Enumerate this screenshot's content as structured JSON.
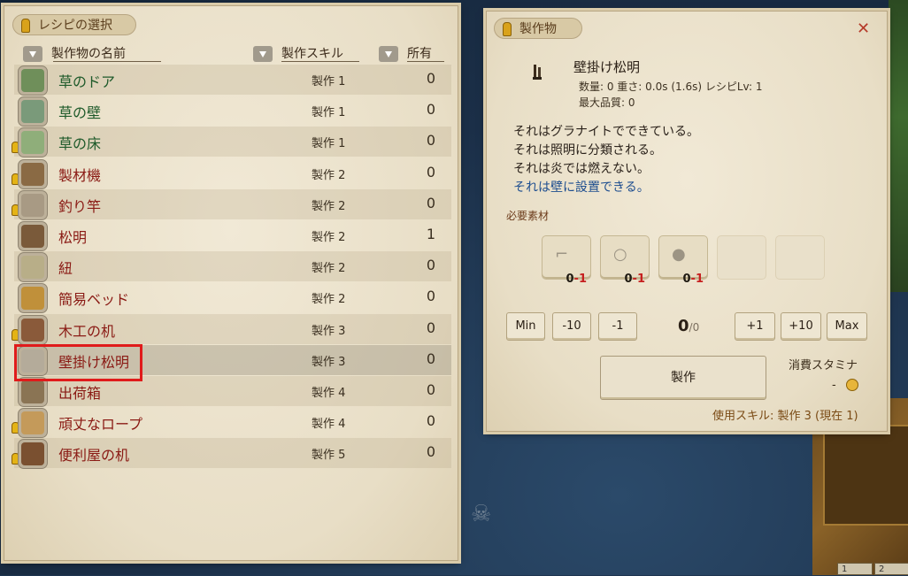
{
  "left_panel": {
    "title": "レシピの選択",
    "headers": {
      "name": "製作物の名前",
      "skill": "製作スキル",
      "owned": "所有"
    },
    "rows": [
      {
        "name": "草のドア",
        "skill": "製作 1",
        "owned": "0",
        "name_color": "#1e5a2a",
        "bulb": false,
        "icon": "grass-door-icon",
        "icon_color": "#6f8f5a"
      },
      {
        "name": "草の壁",
        "skill": "製作 1",
        "owned": "0",
        "name_color": "#1e5a2a",
        "bulb": false,
        "icon": "grass-wall-icon",
        "icon_color": "#7a9a7a"
      },
      {
        "name": "草の床",
        "skill": "製作 1",
        "owned": "0",
        "name_color": "#1e5a2a",
        "bulb": true,
        "icon": "grass-floor-icon",
        "icon_color": "#8fae7a"
      },
      {
        "name": "製材機",
        "skill": "製作 2",
        "owned": "0",
        "name_color": "#8a1a14",
        "bulb": true,
        "icon": "sawmill-icon",
        "icon_color": "#8a6a44"
      },
      {
        "name": "釣り竿",
        "skill": "製作 2",
        "owned": "0",
        "name_color": "#8a1a14",
        "bulb": true,
        "icon": "fishing-rod-icon",
        "icon_color": "#a89a84"
      },
      {
        "name": "松明",
        "skill": "製作 2",
        "owned": "1",
        "name_color": "#8a1a14",
        "bulb": false,
        "icon": "torch-icon",
        "icon_color": "#7a5a3a"
      },
      {
        "name": "紐",
        "skill": "製作 2",
        "owned": "0",
        "name_color": "#8a1a14",
        "bulb": false,
        "icon": "string-icon",
        "icon_color": "#b8ae88"
      },
      {
        "name": "簡易ベッド",
        "skill": "製作 2",
        "owned": "0",
        "name_color": "#8a1a14",
        "bulb": false,
        "icon": "simple-bed-icon",
        "icon_color": "#c0903a"
      },
      {
        "name": "木工の机",
        "skill": "製作 3",
        "owned": "0",
        "name_color": "#8a1a14",
        "bulb": true,
        "icon": "woodwork-desk-icon",
        "icon_color": "#8a5a3a"
      },
      {
        "name": "壁掛け松明",
        "skill": "製作 3",
        "owned": "0",
        "name_color": "#8a1a14",
        "bulb": false,
        "icon": "wall-torch-icon",
        "icon_color": "#b4ab9a"
      },
      {
        "name": "出荷箱",
        "skill": "製作 4",
        "owned": "0",
        "name_color": "#8a1a14",
        "bulb": false,
        "icon": "shipping-box-icon",
        "icon_color": "#8a7454"
      },
      {
        "name": "頑丈なロープ",
        "skill": "製作 4",
        "owned": "0",
        "name_color": "#8a1a14",
        "bulb": true,
        "icon": "sturdy-rope-icon",
        "icon_color": "#c49a5a"
      },
      {
        "name": "便利屋の机",
        "skill": "製作 5",
        "owned": "0",
        "name_color": "#8a1a14",
        "bulb": true,
        "icon": "handyman-desk-icon",
        "icon_color": "#7a5030"
      }
    ]
  },
  "right_panel": {
    "title": "製作物",
    "item_name": "壁掛け松明",
    "meta_line1": "数量: 0  重さ: 0.0s (1.6s)  レシピLv: 1",
    "meta_line2": "最大品質: 0",
    "descriptions": [
      {
        "text": "それはグラナイトでできている。",
        "color": "#2a211a"
      },
      {
        "text": "それは照明に分類される。",
        "color": "#2a211a"
      },
      {
        "text": "それは炎では燃えない。",
        "color": "#2a211a"
      },
      {
        "text": "それは壁に設置できる。",
        "color": "#1d4d8f"
      }
    ],
    "materials_label": "必要素材",
    "materials": [
      {
        "icon": "wall-mount-icon",
        "have": "0",
        "need": "-1"
      },
      {
        "icon": "ring-icon",
        "have": "0",
        "need": "-1"
      },
      {
        "icon": "rock-icon",
        "have": "0",
        "need": "-1"
      }
    ],
    "qty_buttons": {
      "min": "Min",
      "minus10": "-10",
      "minus1": "-1",
      "plus1": "+1",
      "plus10": "+10",
      "max": "Max"
    },
    "qty_value": "0",
    "qty_max": "/0",
    "craft_label": "製作",
    "stamina_label": "消費スタミナ",
    "stamina_value": "-",
    "skill_used": "使用スキル: 製作 3 (現在 1)",
    "close_glyph": "✕"
  },
  "hotbar": [
    "1",
    "2"
  ]
}
